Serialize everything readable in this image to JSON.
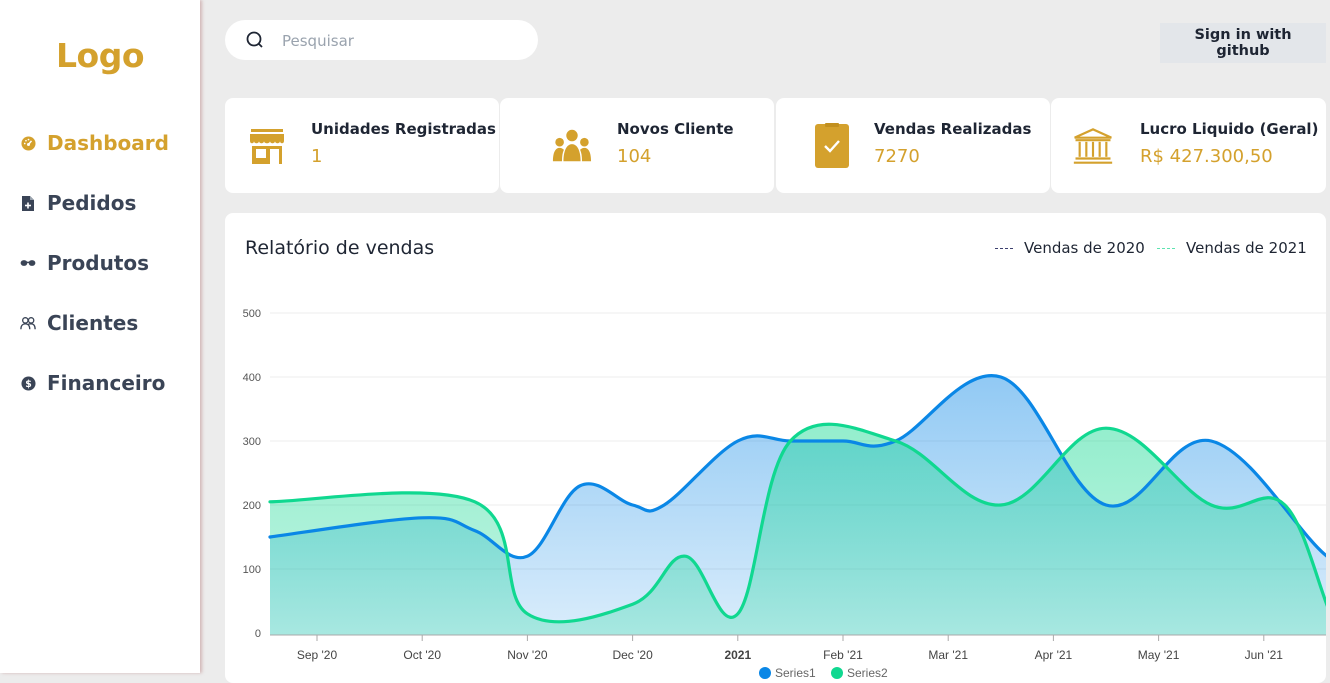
{
  "sidebar": {
    "logo": "Logo",
    "items": [
      {
        "label": "Dashboard",
        "icon": "gauge-icon",
        "active": true
      },
      {
        "label": "Pedidos",
        "icon": "document-plus-icon",
        "active": false
      },
      {
        "label": "Produtos",
        "icon": "glasses-icon",
        "active": false
      },
      {
        "label": "Clientes",
        "icon": "users-icon",
        "active": false
      },
      {
        "label": "Financeiro",
        "icon": "dollar-coin-icon",
        "active": false
      }
    ]
  },
  "search": {
    "placeholder": "Pesquisar",
    "value": ""
  },
  "header": {
    "github_label": "Sign in with github"
  },
  "cards": [
    {
      "title": "Unidades Registradas",
      "value": "1",
      "icon": "store-icon"
    },
    {
      "title": "Novos Cliente",
      "value": "104",
      "icon": "group-icon"
    },
    {
      "title": "Vendas Realizadas",
      "value": "7270",
      "icon": "clipboard-check-icon"
    },
    {
      "title": "Lucro Liquido (Geral)",
      "value": "R$ 427.300,50",
      "icon": "bank-icon"
    }
  ],
  "report": {
    "title": "Relatório de vendas",
    "legend": [
      {
        "label": "Vendas de 2020",
        "color": "#3c3f6e"
      },
      {
        "label": "Vendas de 2021",
        "color": "#5de3b0"
      }
    ]
  },
  "colors": {
    "accent": "#d4a12d",
    "series1": "#0a87e6",
    "series2": "#10d890"
  },
  "chart_data": {
    "type": "area",
    "ylim": [
      0,
      500
    ],
    "yticks": [
      0,
      100,
      200,
      300,
      400,
      500
    ],
    "xticks": [
      {
        "label": "Sep '20",
        "bold": false
      },
      {
        "label": "Oct '20",
        "bold": false
      },
      {
        "label": "Nov '20",
        "bold": false
      },
      {
        "label": "Dec '20",
        "bold": false
      },
      {
        "label": "2021",
        "bold": true
      },
      {
        "label": "Feb '21",
        "bold": false
      },
      {
        "label": "Mar '21",
        "bold": false
      },
      {
        "label": "Apr '21",
        "bold": false
      },
      {
        "label": "May '21",
        "bold": false
      },
      {
        "label": "Jun '21",
        "bold": false
      }
    ],
    "series": [
      {
        "name": "Series1",
        "color": "#0a87e6",
        "x": [
          0,
          1,
          1.5,
          2,
          2.5,
          3,
          3.3,
          4,
          4.5,
          5,
          5.5,
          6.5,
          7.5,
          8.5,
          9.6,
          10
        ],
        "values": [
          150,
          180,
          160,
          120,
          230,
          200,
          200,
          300,
          300,
          300,
          300,
          400,
          200,
          300,
          120,
          110
        ]
      },
      {
        "name": "Series2",
        "color": "#10d890",
        "x": [
          0,
          1.5,
          2,
          3,
          3.5,
          4,
          4.5,
          5.5,
          6.5,
          7.5,
          8.5,
          9.2,
          9.7,
          10
        ],
        "values": [
          205,
          205,
          30,
          45,
          120,
          30,
          300,
          300,
          200,
          320,
          200,
          200,
          10,
          30
        ]
      }
    ]
  }
}
